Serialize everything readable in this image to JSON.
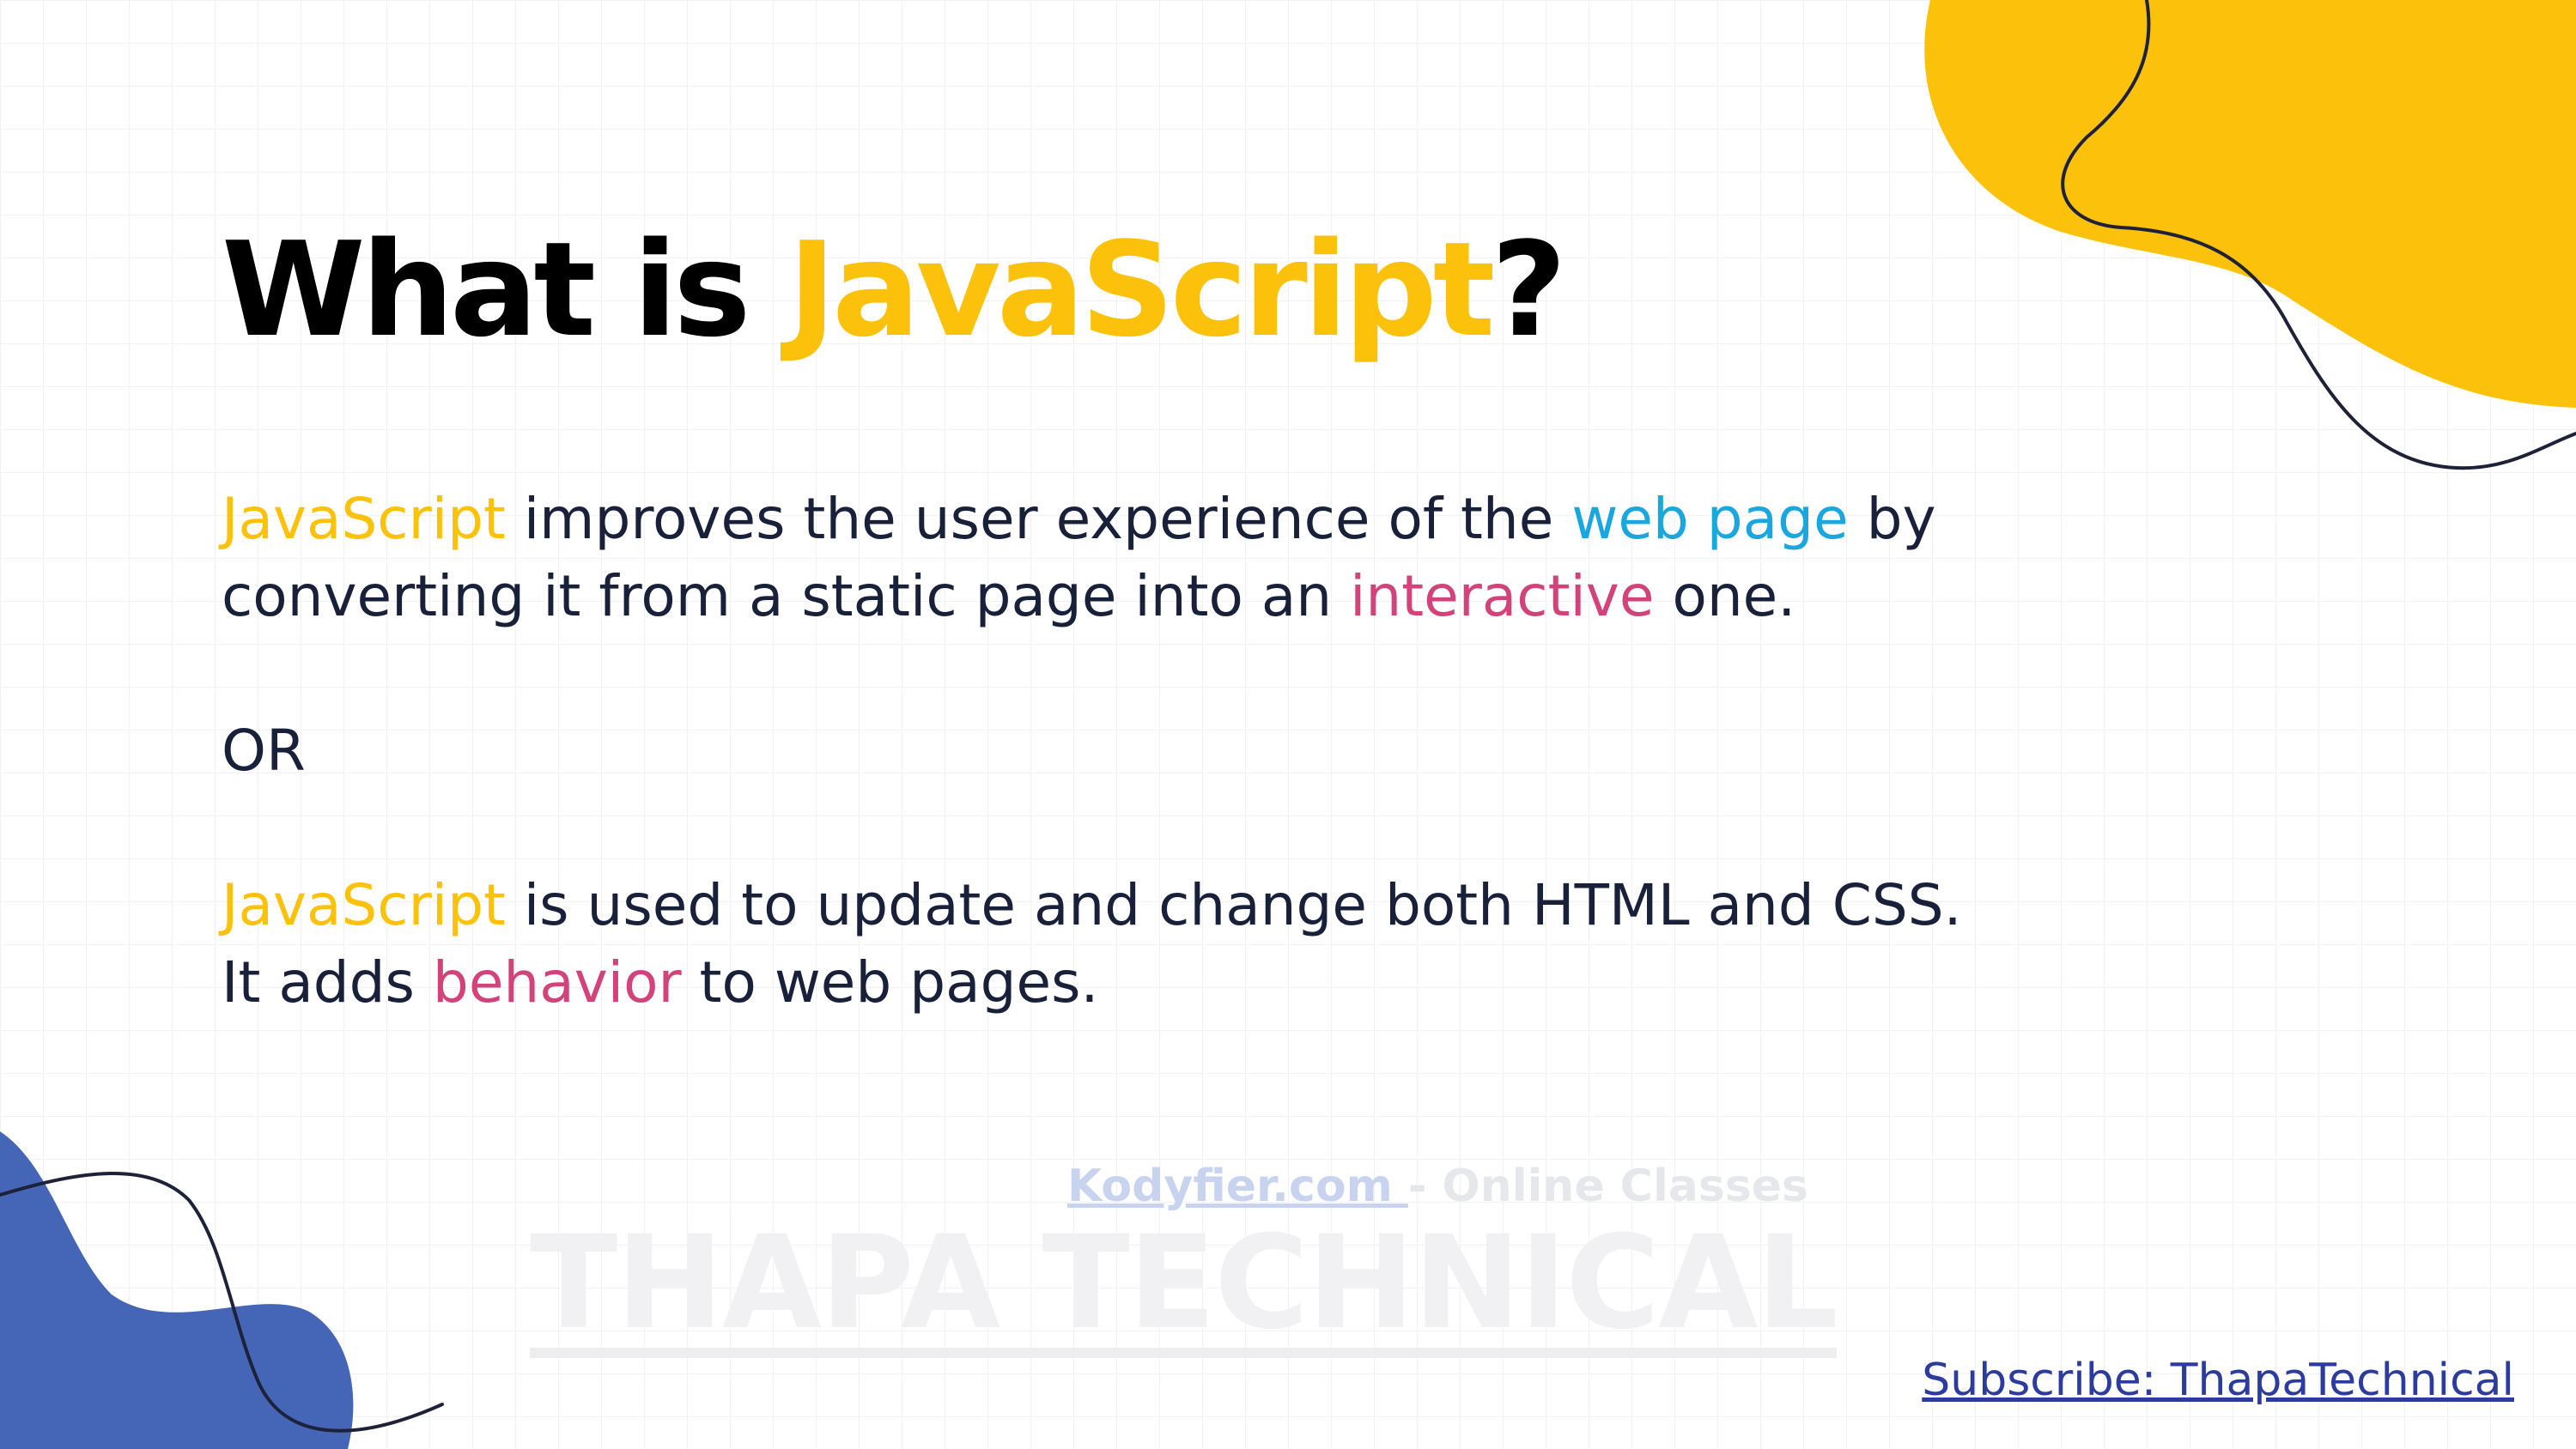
{
  "colors": {
    "accent_yellow": "#fcc10a",
    "accent_blue": "#1aa6de",
    "accent_pink": "#d1437a",
    "body_text": "#19203a",
    "title_text": "#000000",
    "blob_blue": "#4565b7",
    "link": "#2c3c9e"
  },
  "title": {
    "prefix": "What is ",
    "highlight": "JavaScript",
    "suffix": "?"
  },
  "paragraph1": {
    "line1_part1": "JavaScript",
    "line1_part2": " improves the user experience of the ",
    "line1_part3": "web page",
    "line1_part4": " by",
    "line2_part1": "converting it from a static page into an ",
    "line2_part2": "interactive",
    "line2_part3": " one."
  },
  "separator": "OR",
  "paragraph2": {
    "line1_part1": "JavaScript",
    "line1_part2": " is used to update and change both HTML and CSS.",
    "line2_part1": "It adds ",
    "line2_part2": "behavior",
    "line2_part3": " to web pages."
  },
  "watermark": {
    "site": "Kodyfier.com ",
    "tagline": "- Online Classes",
    "brand": "THAPA TECHNICAL"
  },
  "subscribe": "Subscribe: ThapaTechnical"
}
